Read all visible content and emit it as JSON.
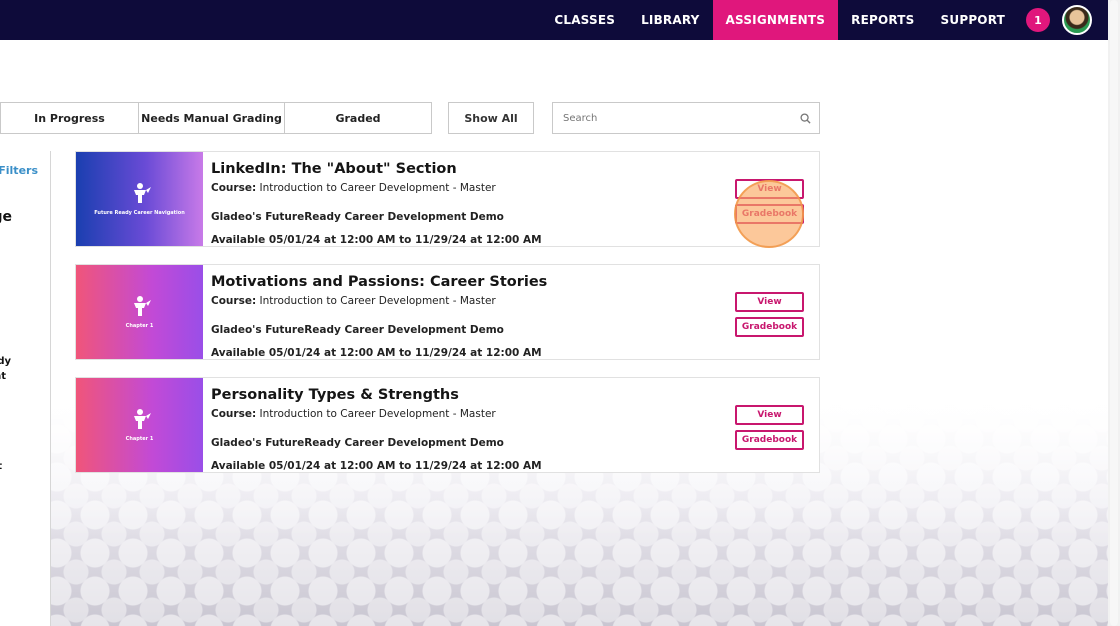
{
  "nav": {
    "items": [
      "CLASSES",
      "LIBRARY",
      "ASSIGNMENTS",
      "REPORTS",
      "SUPPORT"
    ],
    "active": "ASSIGNMENTS",
    "notification_count": "1"
  },
  "filters": {
    "in_progress": "In Progress",
    "needs_manual_grading": "Needs Manual Grading",
    "graded": "Graded",
    "show_all": "Show All",
    "search_placeholder": "Search"
  },
  "left_panel": {
    "filters_link": "Filters",
    "heading_fragment": "ge",
    "text_fragments": [
      "dy",
      "nt",
      "t"
    ]
  },
  "assignments": [
    {
      "title": "LinkedIn: The \"About\" Section",
      "course_label": "Course:",
      "course": "Introduction to Career Development - Master",
      "org": "Gladeo's FutureReady Career Development Demo",
      "availability": "Available 05/01/24 at 12:00 AM to 11/29/24 at 12:00 AM",
      "thumb_label": "Future Ready Career Navigation",
      "view_label": "View",
      "gradebook_label": "Gradebook"
    },
    {
      "title": "Motivations and Passions: Career Stories",
      "course_label": "Course:",
      "course": "Introduction to Career Development - Master",
      "org": "Gladeo's FutureReady Career Development Demo",
      "availability": "Available 05/01/24 at 12:00 AM to 11/29/24 at 12:00 AM",
      "thumb_label": "Chapter 1",
      "view_label": "View",
      "gradebook_label": "Gradebook"
    },
    {
      "title": "Personality Types & Strengths",
      "course_label": "Course:",
      "course": "Introduction to Career Development - Master",
      "org": "Gladeo's FutureReady Career Development Demo",
      "availability": "Available 05/01/24 at 12:00 AM to 11/29/24 at 12:00 AM",
      "thumb_label": "Chapter 1",
      "view_label": "View",
      "gradebook_label": "Gradebook"
    }
  ],
  "colors": {
    "nav_bg": "#0e0b3a",
    "accent": "#e0177c",
    "button_border": "#c8176e",
    "filter_link": "#3a8fc8"
  }
}
